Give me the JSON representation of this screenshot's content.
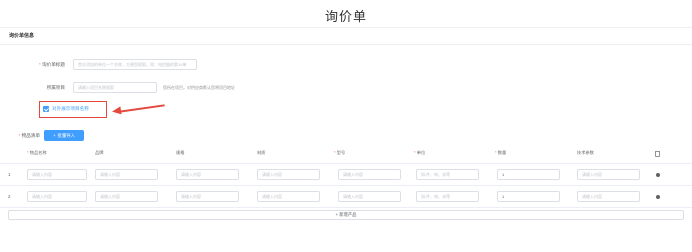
{
  "page": {
    "title": "询价单"
  },
  "section": {
    "title": "询价单信息"
  },
  "form": {
    "title_label": "询价单标题",
    "title_placeholder": "首次添加的单位一个名称，方便您搜索。如：电控器的第15单",
    "project_label": "所属项目",
    "project_placeholder": "请输入项目名称搜索",
    "project_hint": "您所在项目，对供应商默认您将项目地址",
    "show_project_label": "对外展示项目名称",
    "products_label": "物品清单",
    "batch_import_label": "批量导入"
  },
  "table": {
    "columns": [
      {
        "label": "物品名称",
        "required": true
      },
      {
        "label": "品牌",
        "required": false
      },
      {
        "label": "规格",
        "required": false
      },
      {
        "label": "材质",
        "required": false
      },
      {
        "label": "型号",
        "required": true
      },
      {
        "label": "单位",
        "required": true
      },
      {
        "label": "数量",
        "required": true
      },
      {
        "label": "技术参数",
        "required": false
      }
    ],
    "placeholder": "请输入内容",
    "unit_placeholder": "如:件、吨、米等",
    "rows": [
      {
        "index": "1",
        "quantity": "1"
      },
      {
        "index": "2",
        "quantity": "1"
      }
    ],
    "add_product_label": "+ 新增产品"
  },
  "colors": {
    "accent": "#409eff",
    "annotation": "#e5483d"
  },
  "icons": {
    "delete": "trash-icon",
    "remove_row": "remove-row-icon",
    "checkbox": "checkbox-checked-icon"
  }
}
